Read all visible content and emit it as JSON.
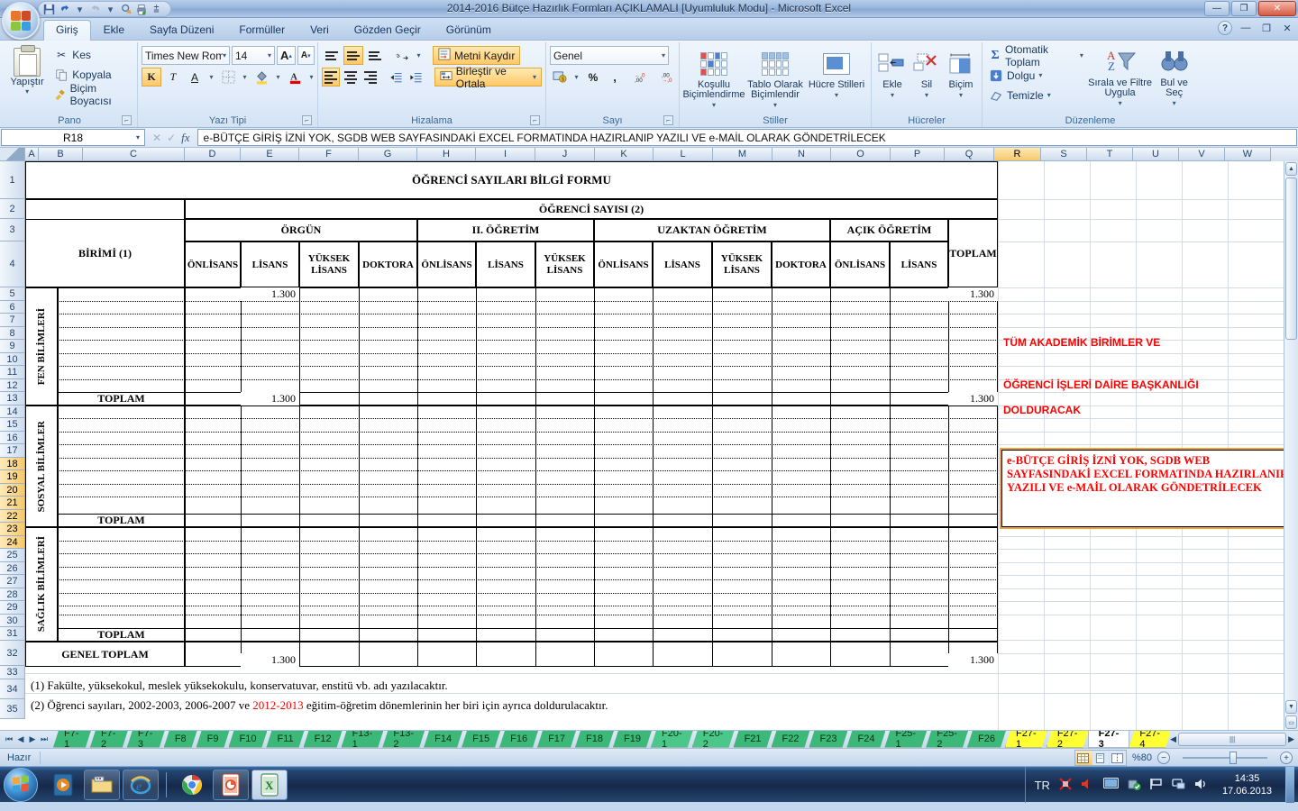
{
  "window": {
    "title": "2014-2016 Bütçe Hazırlık Formları AÇIKLAMALI  [Uyumluluk Modu]  -  Microsoft Excel",
    "minimize": "—",
    "restore": "❐",
    "close": "✕",
    "qat": [
      "save-icon",
      "undo-icon",
      "redo-icon",
      "print-preview-icon",
      "print-icon",
      "customize-icon"
    ]
  },
  "ribbon": {
    "tabs": [
      "Giriş",
      "Ekle",
      "Sayfa Düzeni",
      "Formüller",
      "Veri",
      "Gözden Geçir",
      "Görünüm"
    ],
    "active_tab": "Giriş",
    "help": {
      "question": "?",
      "minimize": "—",
      "restore": "❐",
      "close": "✕"
    },
    "groups": {
      "clipboard": {
        "label": "Pano",
        "paste": "Yapıştır",
        "items": [
          "Kes",
          "Kopyala",
          "Biçim Boyacısı"
        ]
      },
      "font": {
        "label": "Yazı Tipi",
        "font_name": "Times New Rom",
        "font_size": "14",
        "grow": "A",
        "shrink": "A",
        "bold": "K",
        "italic": "T",
        "underline": "A",
        "borders": "borders-icon",
        "fill": "fill-color-icon",
        "fontcolor": "font-color-icon"
      },
      "alignment": {
        "label": "Hizalama",
        "wrap_text": "Metni Kaydır",
        "merge_center": "Birleştir ve Ortala",
        "orientation": "orientation-icon"
      },
      "number": {
        "label": "Sayı",
        "format": "Genel",
        "accounting": "accounting-icon",
        "percent": "%",
        "comma": ",",
        "inc_dec": "+.0 .00",
        "dec_dec": ".00 -.0"
      },
      "styles": {
        "label": "Stiller",
        "items": [
          "Koşullu Biçimlendirme",
          "Tablo Olarak Biçimlendir",
          "Hücre Stilleri"
        ]
      },
      "cells": {
        "label": "Hücreler",
        "items": [
          "Ekle",
          "Sil",
          "Biçim"
        ]
      },
      "editing": {
        "label": "Düzenleme",
        "items": [
          "Otomatik Toplam",
          "Dolgu",
          "Temizle"
        ],
        "sort_filter": "Sırala ve Filtre Uygula",
        "find_select": "Bul ve Seç"
      }
    }
  },
  "formula_bar": {
    "name_box": "R18",
    "cancel": "✕",
    "accept": "✓",
    "fx": "fx",
    "content": "e-BÜTÇE GİRİŞ İZNİ YOK, SGDB WEB SAYFASINDAKİ EXCEL FORMATINDA HAZIRLANIP YAZILI VE e-MAİL OLARAK GÖNDETRİLECEK"
  },
  "grid": {
    "columns": [
      "A",
      "B",
      "C",
      "D",
      "E",
      "F",
      "G",
      "H",
      "I",
      "J",
      "K",
      "L",
      "M",
      "N",
      "O",
      "P",
      "Q",
      "R",
      "S",
      "T",
      "U",
      "V",
      "W"
    ],
    "selected_column": "R",
    "rows": [
      1,
      2,
      3,
      4,
      5,
      6,
      7,
      8,
      9,
      10,
      11,
      12,
      13,
      14,
      15,
      16,
      17,
      18,
      19,
      20,
      21,
      22,
      23,
      24,
      25,
      26,
      27,
      28,
      29,
      30,
      31,
      32,
      33,
      34,
      35
    ],
    "selected_rows": [
      18,
      19,
      20,
      21,
      22,
      23,
      24
    ]
  },
  "sheet": {
    "form_title": "ÖĞRENCİ SAYILARI BİLGİ FORMU",
    "header_unit": "BİRİMİ (1)",
    "header_student_count": "ÖĞRENCİ SAYISI (2)",
    "header_total": "TOPLAM",
    "education_types": [
      "ÖRGÜN",
      "II. ÖĞRETİM",
      "UZAKTAN ÖĞRETİM",
      "AÇIK ÖĞRETİM"
    ],
    "level_headers": {
      "orgun": [
        "ÖNLİSANS",
        "LİSANS",
        "YÜKSEK LİSANS",
        "DOKTORA"
      ],
      "ii_ogretim": [
        "ÖNLİSANS",
        "LİSANS",
        "YÜKSEK LİSANS"
      ],
      "uzaktan": [
        "ÖNLİSANS",
        "LİSANS",
        "YÜKSEK LİSANS",
        "DOKTORA"
      ],
      "acik": [
        "ÖNLİSANS",
        "LİSANS"
      ]
    },
    "sections": [
      {
        "name": "FEN BİLİMLERİ",
        "total_label": "TOPLAM",
        "lisans": "1.300",
        "toplam": "1.300"
      },
      {
        "name": "SOSYAL BİLİMLER",
        "total_label": "TOPLAM",
        "lisans": "",
        "toplam": ""
      },
      {
        "name": "SAĞLIK BİLİMLERİ",
        "total_label": "TOPLAM",
        "lisans": "",
        "toplam": ""
      }
    ],
    "grand_total_label": "GENEL TOPLAM",
    "grand_total_lisans": "1.300",
    "grand_total_toplam": "1.300",
    "data_rows": {
      "lisans_row5": "1.300",
      "toplam_row5": "1.300"
    },
    "side_notes": {
      "line1": "TÜM AKADEMİK BİRİMLER VE",
      "line2": "ÖĞRENCİ İŞLERİ DAİRE BAŞKANLIĞI",
      "line3": "DOLDURACAK",
      "boxed": "e-BÜTÇE GİRİŞ İZNİ YOK, SGDB WEB SAYFASINDAKİ EXCEL FORMATINDA HAZIRLANIP YAZILI VE e-MAİL OLARAK GÖNDETRİLECEK"
    },
    "footnotes": {
      "n1": "(1) Fakülte, yüksekokul, meslek yüksekokulu, konservatuvar, enstitü vb. adı yazılacaktır.",
      "n2_a": "(2) Öğrenci sayıları, 2002-2003, 2006-2007 ve ",
      "n2_red": "2012-2013",
      "n2_b": " eğitim-öğretim dönemlerinin her biri için ayrıca doldurulacaktır."
    }
  },
  "sheet_tabs": {
    "nav": [
      "⏮",
      "◀",
      "▶",
      "⏭"
    ],
    "tabs": [
      {
        "label": "F7-1",
        "color": "green"
      },
      {
        "label": "F7-2",
        "color": "green"
      },
      {
        "label": "F7-3",
        "color": "green"
      },
      {
        "label": "F8",
        "color": "green"
      },
      {
        "label": "F9",
        "color": "green"
      },
      {
        "label": "F10",
        "color": "green"
      },
      {
        "label": "F11",
        "color": "green"
      },
      {
        "label": "F12",
        "color": "green"
      },
      {
        "label": "F13-1",
        "color": "green"
      },
      {
        "label": "F13-2",
        "color": "green"
      },
      {
        "label": "F14",
        "color": "green"
      },
      {
        "label": "F15",
        "color": "green"
      },
      {
        "label": "F16",
        "color": "green"
      },
      {
        "label": "F17",
        "color": "green"
      },
      {
        "label": "F18",
        "color": "green"
      },
      {
        "label": "F19",
        "color": "green"
      },
      {
        "label": "F20-1",
        "color": "green-l"
      },
      {
        "label": "F20-2",
        "color": "green-l"
      },
      {
        "label": "F21",
        "color": "green"
      },
      {
        "label": "F22",
        "color": "green"
      },
      {
        "label": "F23",
        "color": "green"
      },
      {
        "label": "F24",
        "color": "green"
      },
      {
        "label": "F25-1",
        "color": "green"
      },
      {
        "label": "F25-2",
        "color": "green"
      },
      {
        "label": "F26",
        "color": "green"
      },
      {
        "label": "F27-1",
        "color": "yellow"
      },
      {
        "label": "F27-2",
        "color": "yellow"
      },
      {
        "label": "F27-3",
        "color": "active"
      },
      {
        "label": "F27-4",
        "color": "yellow"
      }
    ]
  },
  "status_bar": {
    "state": "Hazır",
    "zoom": "%80",
    "zoom_out": "−",
    "zoom_in": "+",
    "views": [
      "normal-view-icon",
      "page-layout-icon",
      "page-break-icon"
    ]
  },
  "taskbar": {
    "start": "start-orb-icon",
    "items": [
      "media-player-icon",
      "explorer-icon",
      "internet-explorer-icon",
      "chrome-icon",
      "powerpoint-icon",
      "excel-icon"
    ],
    "tray_lang": "TR",
    "tray_icons": [
      "antivirus-icon",
      "volume-red-icon",
      "display-icon",
      "security-icon",
      "flag-icon",
      "network-icon",
      "speaker-icon"
    ],
    "time": "14:35",
    "date": "17.06.2013"
  },
  "colors": {
    "accent_red": "#ff0000",
    "tab_green": "#3cb878",
    "tab_yellow": "#ffff33",
    "selection_orange": "#f0a030"
  }
}
